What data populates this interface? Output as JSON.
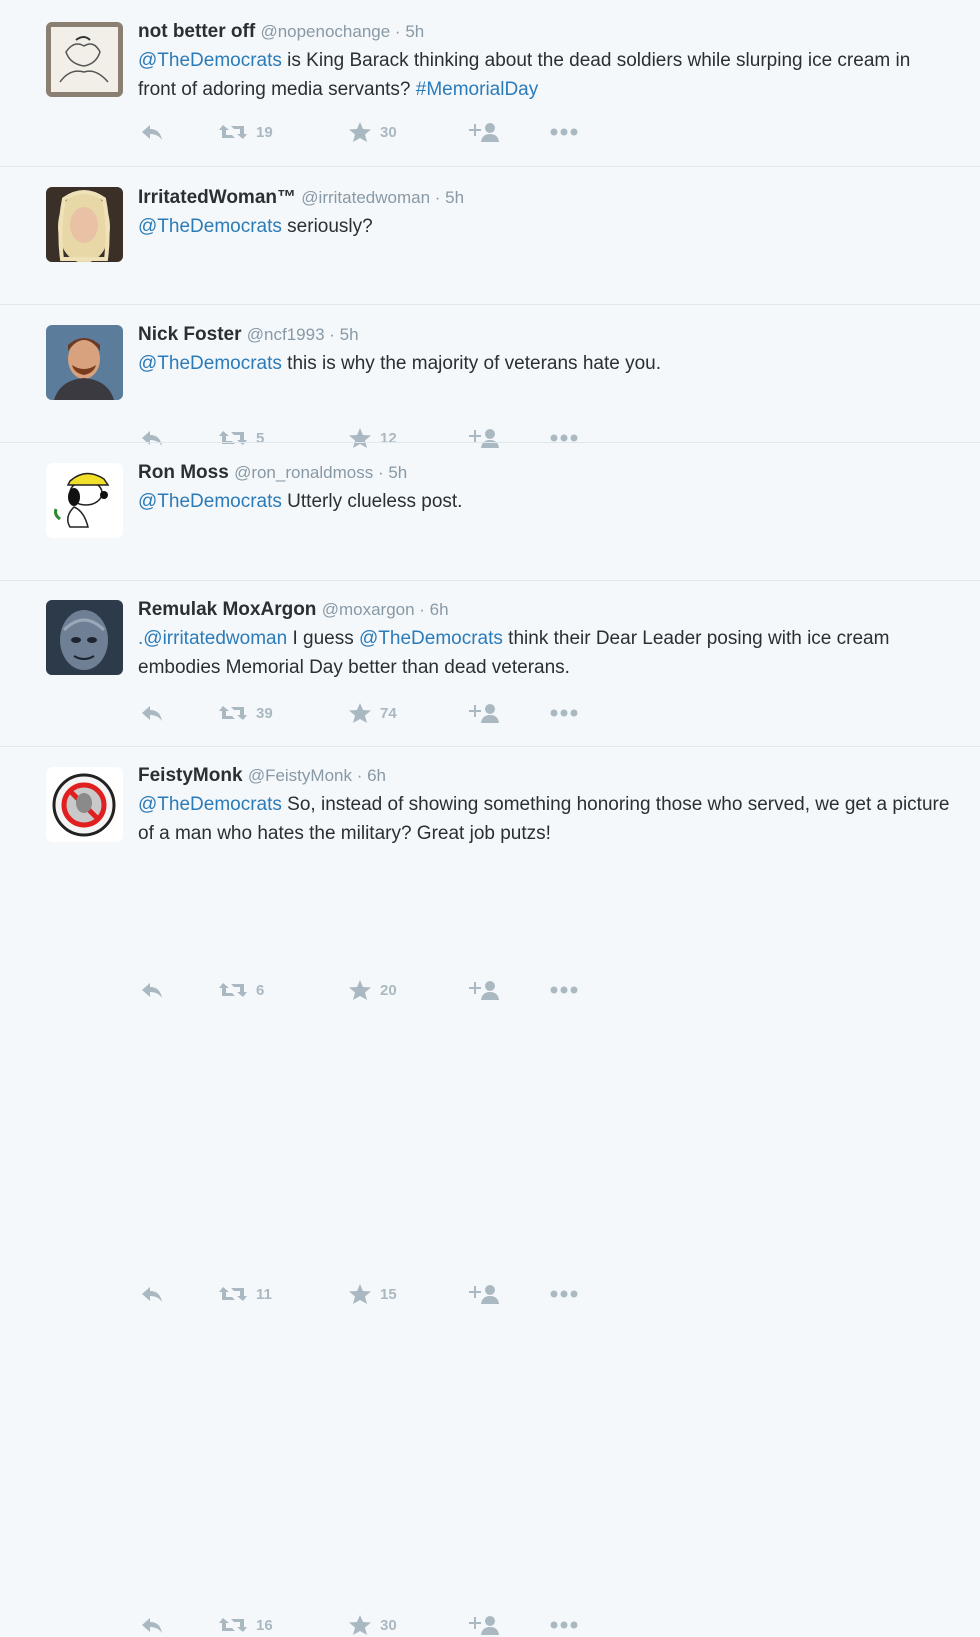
{
  "tweets": [
    {
      "fullname": "not better off",
      "username": "@nopenochange",
      "time": "5h",
      "mention": "@TheDemocrats",
      "text_before": " is King Barack thinking about the dead soldiers while slurping ice cream in front of adoring media servants? ",
      "hashtag": "#MemorialDay",
      "retweets": "19",
      "favorites": "30"
    },
    {
      "fullname": "IrritatedWoman™",
      "username": "@irritatedwoman",
      "time": "5h",
      "mention": "@TheDemocrats",
      "text_before": " seriously?",
      "retweets": "5",
      "favorites": "12"
    },
    {
      "fullname": "Nick Foster",
      "username": "@ncf1993",
      "time": "5h",
      "mention": "@TheDemocrats",
      "text_before": " this is why the majority of veterans hate you.",
      "retweets": "39",
      "favorites": "74"
    },
    {
      "fullname": "Ron Moss",
      "username": "@ron_ronaldmoss",
      "time": "5h",
      "mention": "@TheDemocrats",
      "text_before": " Utterly clueless post.",
      "retweets": "6",
      "favorites": "20"
    },
    {
      "fullname": "Remulak MoxArgon",
      "username": "@moxargon",
      "time": "6h",
      "prefix": ".",
      "mention1": "@irritatedwoman",
      "mid": " I guess ",
      "mention": "@TheDemocrats",
      "text_before": " think their Dear Leader posing with ice cream embodies Memorial Day better than dead veterans.",
      "retweets": "11",
      "favorites": "15"
    },
    {
      "fullname": "FeistyMonk",
      "username": "@FeistyMonk",
      "time": "6h",
      "mention": "@TheDemocrats",
      "text_before": " So, instead of showing something honoring those who served, we get a picture of a man who hates the military? Great job putzs!",
      "retweets": "16",
      "favorites": "30"
    }
  ],
  "separator": " · ",
  "icons": {
    "reply": "reply-icon",
    "retweet": "retweet-icon",
    "favorite": "star-icon",
    "follow": "follow-icon",
    "more": "more-icon"
  },
  "colors": {
    "link": "#2b7bb9",
    "meta": "#8899a6",
    "action": "#aab8c2",
    "background": "#f5f8fa"
  }
}
